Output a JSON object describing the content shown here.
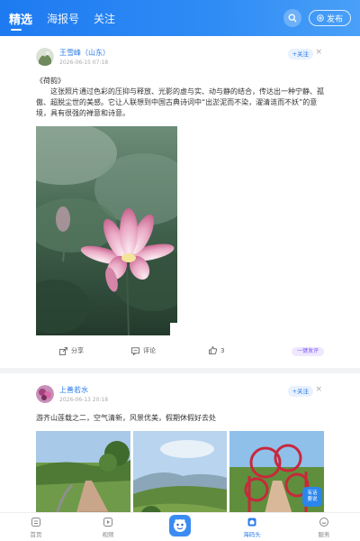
{
  "header": {
    "tabs": [
      {
        "label": "精选",
        "active": true
      },
      {
        "label": "海报号",
        "active": false
      },
      {
        "label": "关注",
        "active": false
      }
    ],
    "search_icon": "search-icon",
    "publish_label": "发布"
  },
  "posts": [
    {
      "author": "王雪峰（山东）",
      "time": "2026-06-15 07:18",
      "follow_label": "+关注",
      "title": "《荷韵》",
      "body": "这张照片通过色彩的压抑与释放、光影的虚与实、动与静的结合，传达出一种宁静、孤傲、超脱尘世的美感。它让人联想到中国古典诗词中“出淤泥而不染，濯清涟而不妖”的意境，具有很强的禅意和诗意。",
      "actions": {
        "share": "分享",
        "comment": "评论",
        "like_count": "3",
        "onekey": "一键发评"
      }
    },
    {
      "author": "上善若水",
      "time": "2026-06-13 20:18",
      "follow_label": "+关注",
      "body": "游齐山莲载之二，空气清新，风景优美，假期休假好去处",
      "badge_line1": "有话",
      "badge_line2": "要说"
    }
  ],
  "bottom_nav": [
    {
      "label": "首页",
      "active": false
    },
    {
      "label": "视频",
      "active": false
    },
    {
      "label": "",
      "active": false
    },
    {
      "label": "海码头",
      "active": true
    },
    {
      "label": "服务",
      "active": false
    }
  ],
  "colors": {
    "accent": "#2a7ce8",
    "header": "#1e7af0"
  }
}
